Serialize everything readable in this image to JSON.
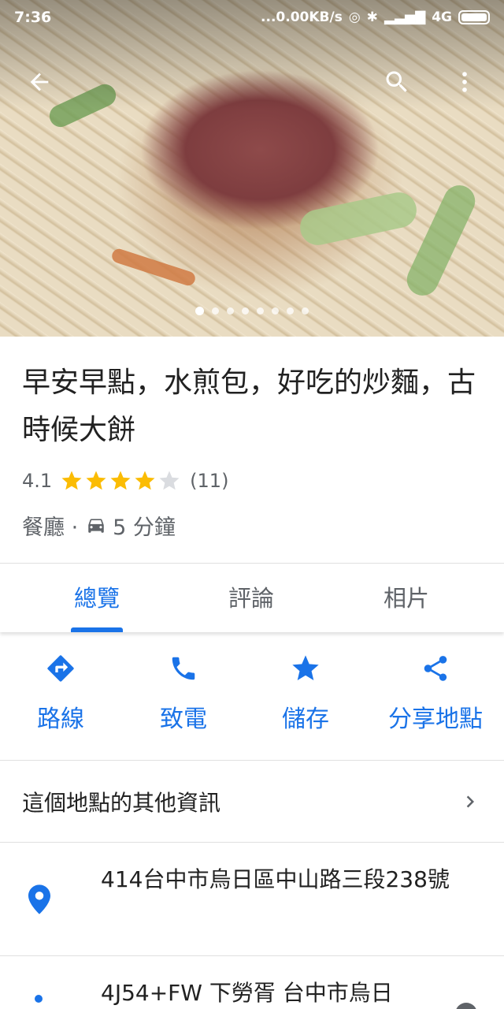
{
  "status_bar": {
    "time": "7:36",
    "network_speed": "...0.00KB/s",
    "network": "4G"
  },
  "gallery": {
    "photo_count": 8,
    "active_index": 0
  },
  "place": {
    "title": "早安早點，水煎包，好吃的炒麵，古時候大餅",
    "rating": "4.1",
    "rating_value": 4.1,
    "review_count": "(11)",
    "category": "餐廳 ·",
    "drive_time": "5 分鐘"
  },
  "tabs": [
    {
      "label": "總覽",
      "active": true
    },
    {
      "label": "評論",
      "active": false
    },
    {
      "label": "相片",
      "active": false
    }
  ],
  "actions": [
    {
      "label": "路線",
      "icon": "directions-icon"
    },
    {
      "label": "致電",
      "icon": "phone-icon"
    },
    {
      "label": "儲存",
      "icon": "star-icon"
    },
    {
      "label": "分享地點",
      "icon": "share-icon"
    }
  ],
  "more_info": {
    "label": "這個地點的其他資訊"
  },
  "address": {
    "text": "414台中市烏日區中山路三段238號"
  },
  "plus_code": {
    "text": "4J54+FW 下勞胥 台中市烏日"
  },
  "colors": {
    "accent": "#1a73e8",
    "star": "#fbbc04",
    "star_empty": "#dadce0"
  }
}
